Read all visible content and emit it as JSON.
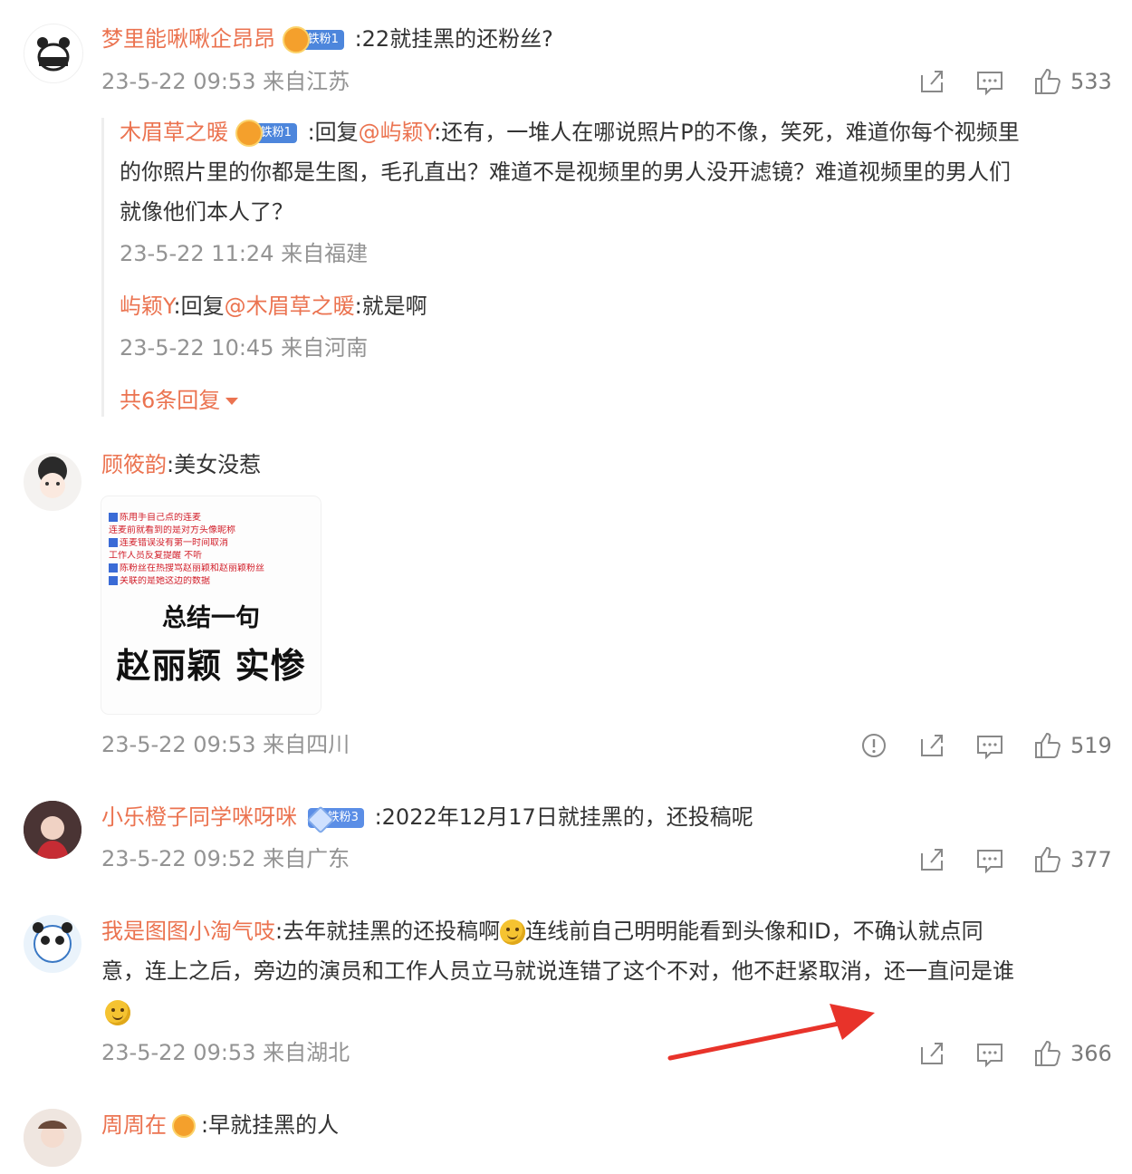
{
  "comments": [
    {
      "username": "梦里能啾啾企昂昂",
      "badge": "铁粉1",
      "text": ":22就挂黑的还粉丝?",
      "meta": "23-5-22 09:53 来自江苏",
      "likes": "533",
      "replies": [
        {
          "username": "木眉草之暖",
          "badge": "铁粉1",
          "reply_prefix": ":回复",
          "mention": "@屿颖Y",
          "line1": ":还有，一堆人在哪说照片P的不像，笑死，难道你每个视频里",
          "line2": "的你照片里的你都是生图，毛孔直出？难道不是视频里的男人没开滤镜？难道视频里的男人们",
          "line3": "就像他们本人了？",
          "meta": "23-5-22 11:24 来自福建"
        },
        {
          "username": "屿颖Y",
          "reply_prefix": ":回复",
          "mention": "@木眉草之暖",
          "text": ":就是啊",
          "meta": "23-5-22 10:45 来自河南"
        }
      ],
      "more_replies": "共6条回复"
    },
    {
      "username": "顾筱韵",
      "text": ":美女没惹",
      "image": {
        "red_lines": [
          "陈用手自己点的连麦",
          "连麦前就看到的是对方头像昵称",
          "连麦错误没有第一时间取消",
          "工作人员反复提醒 不听",
          "陈粉丝在热搜骂赵丽颖和赵丽颖粉丝",
          "关联的是她这边的数据"
        ],
        "summary_line1": "总结一句",
        "summary_line2": "赵丽颖 实惨"
      },
      "meta": "23-5-22 09:53 来自四川",
      "likes": "519"
    },
    {
      "username": "小乐橙子同学咪呀咪",
      "badge": "铁粉3",
      "text": ":2022年12月17日就挂黑的，还投稿呢",
      "meta": "23-5-22 09:52 来自广东",
      "likes": "377"
    },
    {
      "username": "我是图图小淘气吱",
      "line1a": ":去年就挂黑的还投稿啊",
      "line1b": "连线前自己明明能看到头像和ID，不确认就点同",
      "line2": "意，连上之后，旁边的演员和工作人员立马就说连错了这个不对，他不赶紧取消，还一直问是谁",
      "meta": "23-5-22 09:53 来自湖北",
      "likes": "366"
    },
    {
      "username": "周周在",
      "text": ":早就挂黑的人"
    }
  ],
  "colors": {
    "username": "#eb7350",
    "meta": "#939393",
    "arrow": "#e8332a"
  }
}
